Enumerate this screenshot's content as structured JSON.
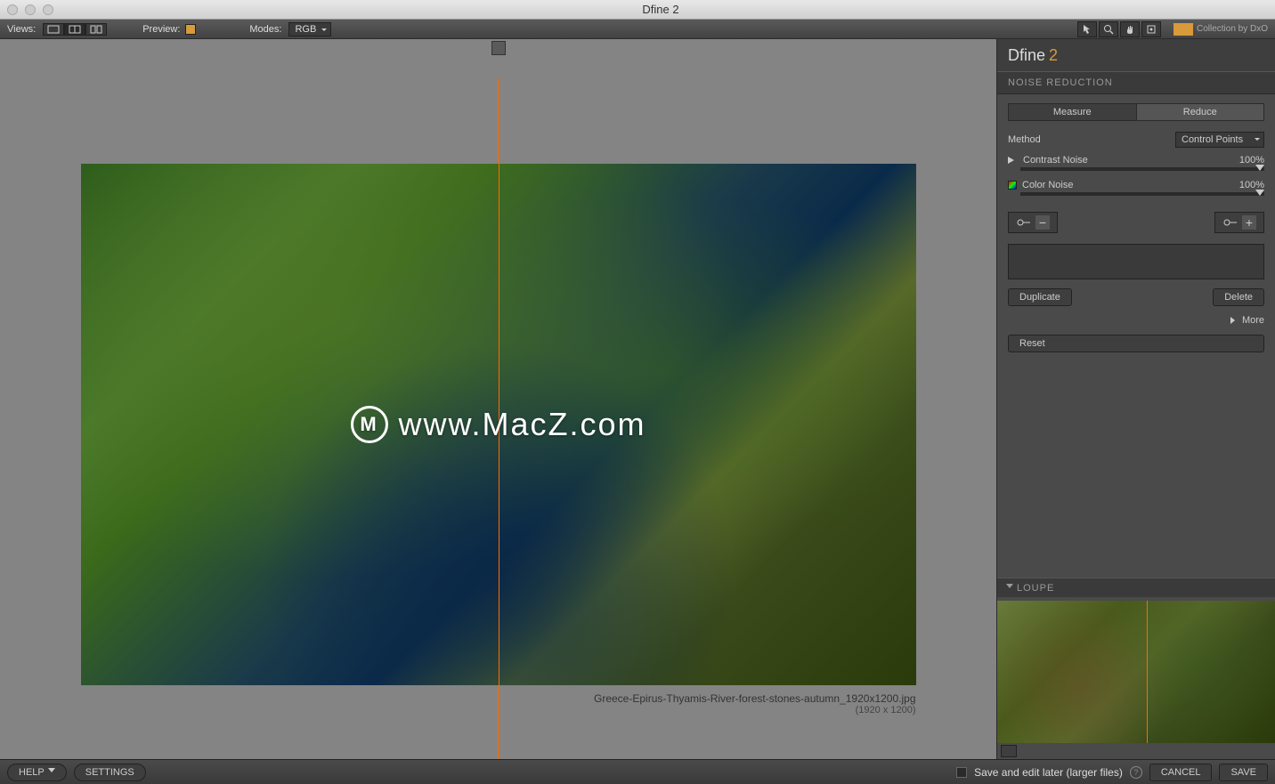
{
  "window_title": "Dfine 2",
  "toolbar": {
    "views_label": "Views:",
    "preview_label": "Preview:",
    "modes_label": "Modes:",
    "modes_value": "RGB"
  },
  "brand": {
    "name": "Dfine",
    "version": "2",
    "collection": "Collection by DxO"
  },
  "panel": {
    "section_title": "NOISE REDUCTION",
    "tabs": {
      "measure": "Measure",
      "reduce": "Reduce"
    },
    "method_label": "Method",
    "method_value": "Control Points",
    "contrast_label": "Contrast Noise",
    "contrast_value": "100%",
    "color_label": "Color Noise",
    "color_value": "100%",
    "duplicate": "Duplicate",
    "delete": "Delete",
    "more": "More",
    "reset": "Reset"
  },
  "loupe": {
    "title": "LOUPE"
  },
  "file": {
    "name": "Greece-Epirus-Thyamis-River-forest-stones-autumn_1920x1200.jpg",
    "dims": "(1920 x 1200)"
  },
  "watermark": "www.MacZ.com",
  "bottom": {
    "help": "HELP",
    "settings": "SETTINGS",
    "save_later": "Save and edit later (larger files)",
    "cancel": "CANCEL",
    "save": "SAVE"
  }
}
